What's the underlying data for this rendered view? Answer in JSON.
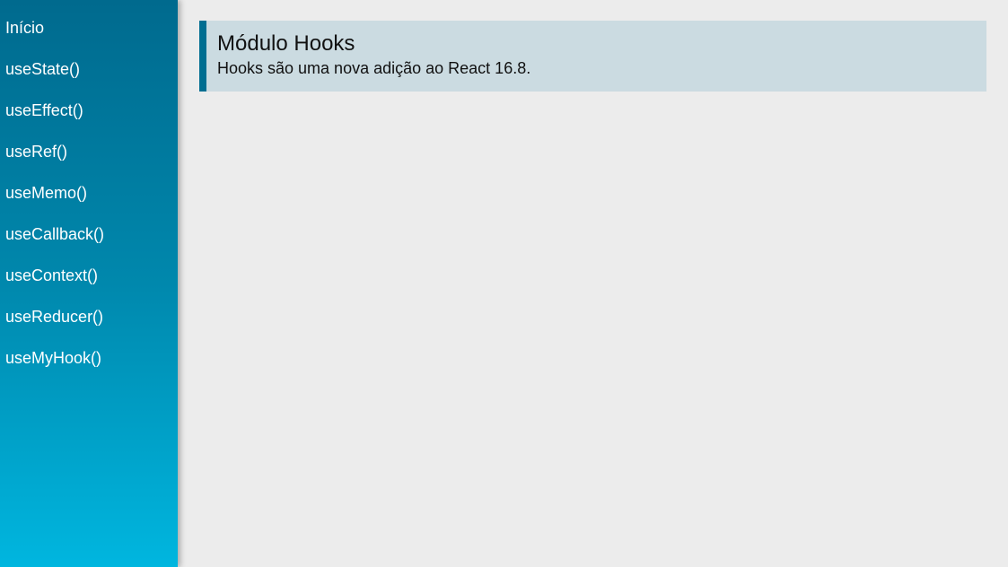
{
  "sidebar": {
    "items": [
      {
        "label": "Início"
      },
      {
        "label": "useState()"
      },
      {
        "label": "useEffect()"
      },
      {
        "label": "useRef()"
      },
      {
        "label": "useMemo()"
      },
      {
        "label": "useCallback()"
      },
      {
        "label": "useContext()"
      },
      {
        "label": "useReducer()"
      },
      {
        "label": "useMyHook()"
      }
    ]
  },
  "main": {
    "card": {
      "title": "Módulo Hooks",
      "text": "Hooks são uma nova adição ao React 16.8."
    }
  },
  "colors": {
    "sidebar_top": "#006a8e",
    "sidebar_bottom": "#00b6df",
    "card_background": "#cbdbe1",
    "card_accent": "#006e91",
    "page_background": "#ececec"
  }
}
